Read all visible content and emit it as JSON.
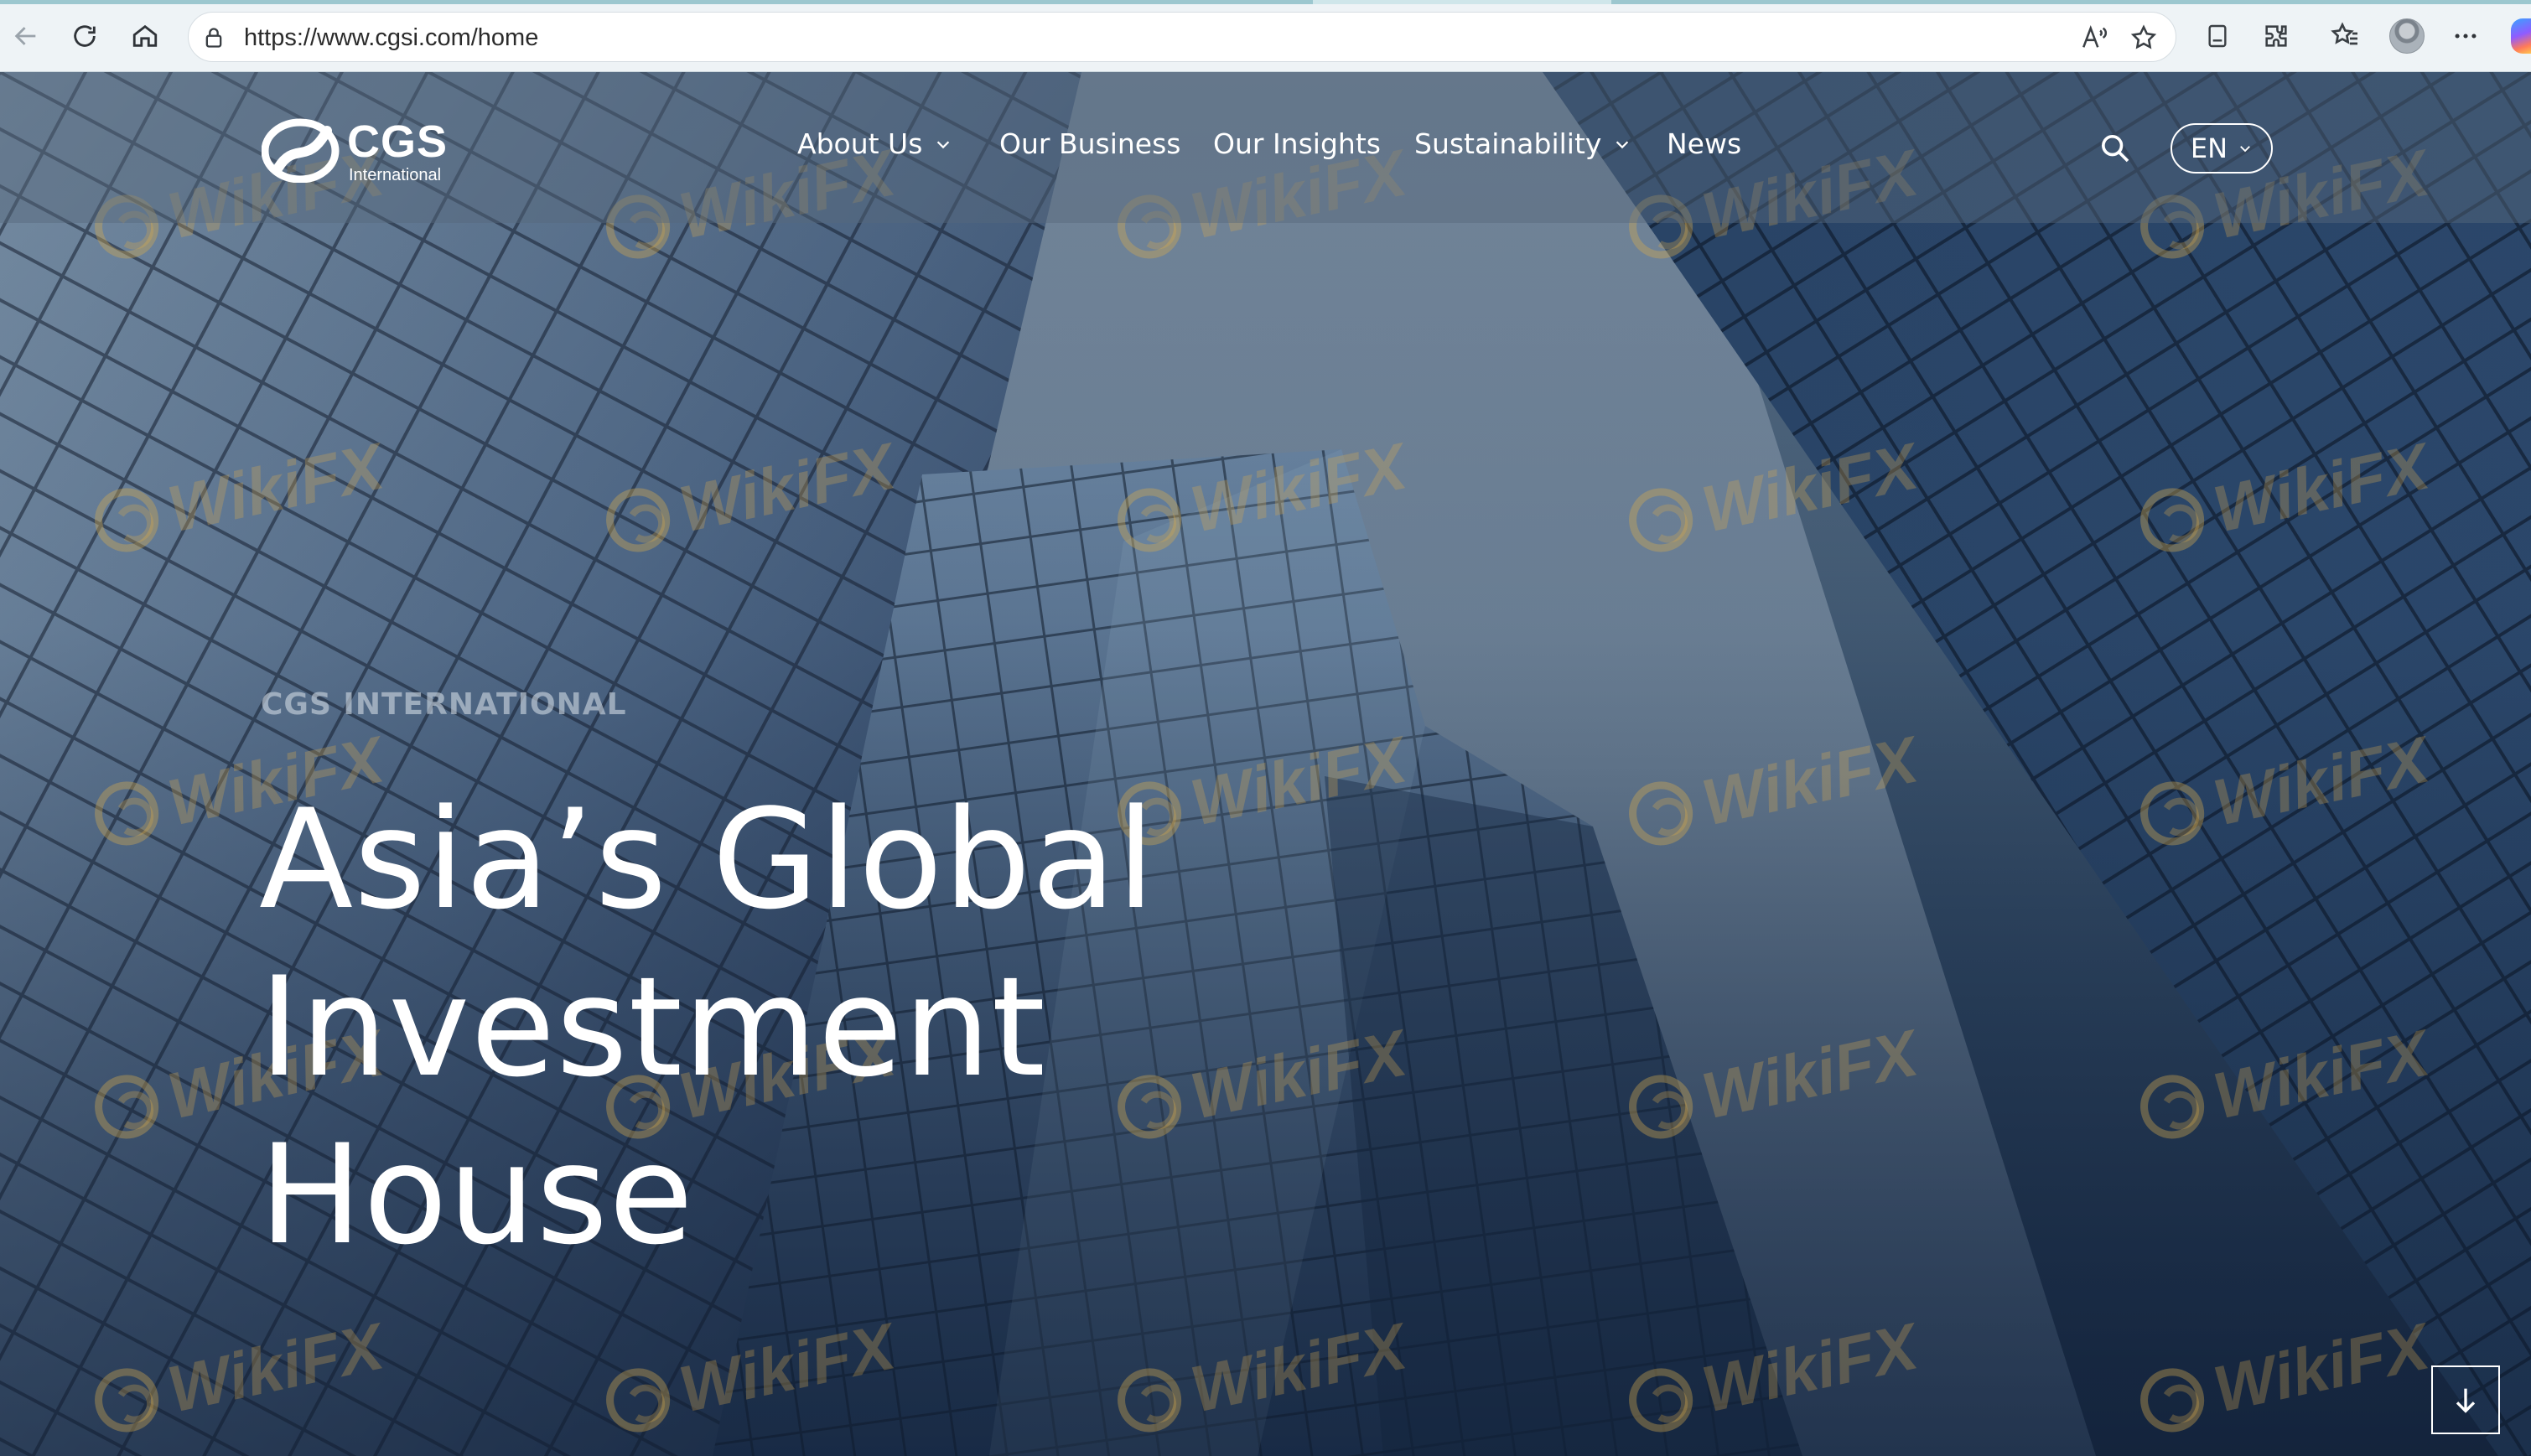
{
  "browser": {
    "url": "https://www.cgsi.com/home",
    "icons": [
      "back-arrow-icon",
      "refresh-icon",
      "home-icon",
      "lock-icon",
      "read-aloud-icon",
      "favorite-star-icon",
      "reading-view-icon",
      "extensions-icon",
      "favorites-icon",
      "profile-avatar",
      "more-menu-icon"
    ]
  },
  "site": {
    "logo": {
      "wordmark": "CGS",
      "subtitle": "International"
    },
    "nav": [
      {
        "label": "About Us",
        "has_dropdown": true
      },
      {
        "label": "Our Business",
        "has_dropdown": false
      },
      {
        "label": "Our Insights",
        "has_dropdown": false
      },
      {
        "label": "Sustainability",
        "has_dropdown": true
      },
      {
        "label": "News",
        "has_dropdown": false
      }
    ],
    "language": "EN"
  },
  "hero": {
    "eyebrow": "CGS INTERNATIONAL",
    "headline_line1": "Asia’s Global",
    "headline_line2": "Investment House"
  },
  "watermark": {
    "text": "WikiFX"
  },
  "colors": {
    "chrome_bg": "#eef3f6",
    "header_overlay": "rgba(86,104,124,0.45)",
    "text_white": "#ffffff",
    "watermark": "#d6aa4e"
  }
}
